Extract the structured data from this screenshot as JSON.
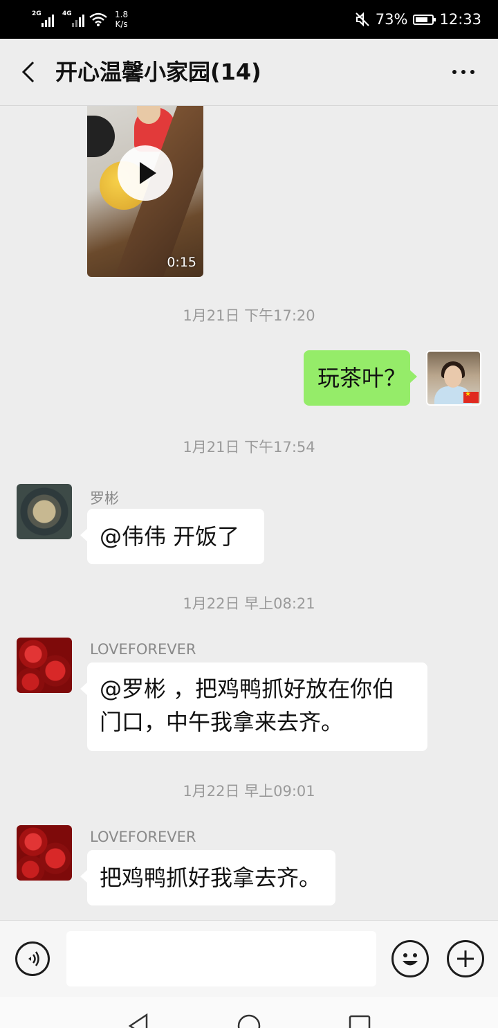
{
  "status_bar": {
    "signal1_tag": "2G",
    "signal2_tag": "4G",
    "speed_value": "1.8",
    "speed_unit": "K/s",
    "battery": "73%",
    "battery_level": 0.73,
    "time": "12:33"
  },
  "header": {
    "title": "开心温馨小家园(14)"
  },
  "video": {
    "duration": "0:15"
  },
  "timestamps": [
    "1月21日 下午17:20",
    "1月21日 下午17:54",
    "1月22日 早上08:21",
    "1月22日 早上09:01"
  ],
  "messages": [
    {
      "sender": "",
      "text": "玩茶叶？",
      "side": "right"
    },
    {
      "sender": "罗彬",
      "text": "@伟伟  开饭了",
      "side": "left"
    },
    {
      "sender": "LOVEFOREVER",
      "line1": "@罗彬 ，把鸡鸭抓好放在你伯",
      "line2": "门口，中午我拿来去齐。",
      "side": "left"
    },
    {
      "sender": "LOVEFOREVER",
      "text": "把鸡鸭抓好我拿去齐。",
      "side": "left"
    }
  ],
  "icons": {
    "back": "chevron-left-icon",
    "more": "more-dots-icon",
    "voice": "voice-icon",
    "emoji": "emoji-icon",
    "plus": "plus-icon",
    "nav_back": "triangle-back-icon",
    "nav_home": "circle-home-icon",
    "nav_recent": "square-recent-icon"
  },
  "colors": {
    "chat_bg": "#ededed",
    "bubble_self": "#95ec69",
    "bubble_other": "#ffffff",
    "meta_text": "#9a9a9a"
  }
}
